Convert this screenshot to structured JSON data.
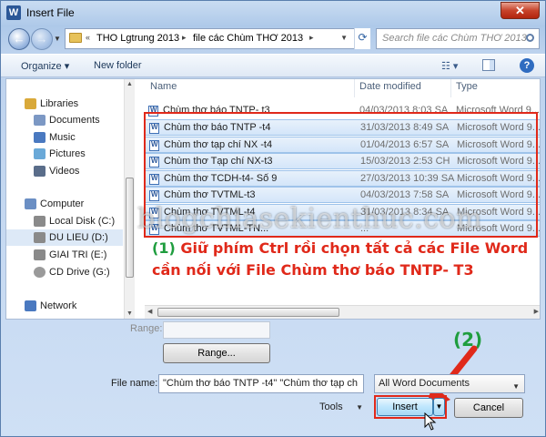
{
  "window": {
    "title": "Insert File",
    "close": "✕"
  },
  "nav": {
    "path": [
      "THO Lgtrung 2013",
      "file các Chùm THƠ 2013"
    ],
    "search_placeholder": "Search file các Chùm THƠ 2013"
  },
  "toolbar": {
    "organize": "Organize ▾",
    "new_folder": "New folder"
  },
  "tree": [
    {
      "label": "Libraries",
      "icon": "libraries-icon",
      "color": "#d9a93a"
    },
    {
      "label": "Documents",
      "icon": "documents-icon",
      "color": "#7c98c4"
    },
    {
      "label": "Music",
      "icon": "music-icon",
      "color": "#4a79c0"
    },
    {
      "label": "Pictures",
      "icon": "pictures-icon",
      "color": "#6aa9d8"
    },
    {
      "label": "Videos",
      "icon": "videos-icon",
      "color": "#5a6d8a"
    },
    {
      "label": "Computer",
      "icon": "computer-icon",
      "color": "#6b8fc4"
    },
    {
      "label": "Local Disk (C:)",
      "icon": "disk-icon",
      "color": "#8a8a8a"
    },
    {
      "label": "DU LIEU (D:)",
      "icon": "disk-icon",
      "color": "#8a8a8a"
    },
    {
      "label": "GIAI TRI (E:)",
      "icon": "disk-icon",
      "color": "#8a8a8a"
    },
    {
      "label": "CD Drive (G:)",
      "icon": "cd-drive-icon",
      "color": "#9a9a9a"
    },
    {
      "label": "Network",
      "icon": "network-icon",
      "color": "#4a79c0"
    }
  ],
  "columns": {
    "name": "Name",
    "date": "Date modified",
    "type": "Type"
  },
  "files": [
    {
      "name": "Chùm thơ báo TNTP- t3",
      "date": "04/03/2013 8:03 SA",
      "type": "Microsoft Word 9...",
      "selected": false
    },
    {
      "name": "Chùm thơ báo TNTP -t4",
      "date": "31/03/2013 8:49 SA",
      "type": "Microsoft Word 9...",
      "selected": true
    },
    {
      "name": "Chùm thơ tạp chí NX -t4",
      "date": "01/04/2013 6:57 SA",
      "type": "Microsoft Word 9...",
      "selected": true
    },
    {
      "name": "Chùm thơ Tạp chí NX-t3",
      "date": "15/03/2013 2:53 CH",
      "type": "Microsoft Word 9...",
      "selected": true
    },
    {
      "name": "Chùm thơ TCDH-t4- Số 9",
      "date": "27/03/2013 10:39 SA",
      "type": "Microsoft Word 9...",
      "selected": true
    },
    {
      "name": "Chùm thơ TVTML-t3",
      "date": "04/03/2013 7:58 SA",
      "type": "Microsoft Word 9...",
      "selected": true
    },
    {
      "name": "Chùm thơ TVTML-t4",
      "date": "31/03/2013 8:34 SA",
      "type": "Microsoft Word 9...",
      "selected": true
    },
    {
      "name": "Chùm thơ TVTML-TN...",
      "date": "...",
      "type": "Microsoft Word 9...",
      "selected": true
    }
  ],
  "annotation1": {
    "num": "(1)",
    "text": "Giữ phím Ctrl rồi chọn tất cả các File Word cần nối với File Chùm thơ báo TNTP- T3"
  },
  "annotation2": "(2)",
  "watermark": "blogchiasekienthuc.com",
  "range": {
    "label": "Range:",
    "button": "Range..."
  },
  "filename": {
    "label": "File name:",
    "value": "\"Chùm thơ báo TNTP -t4\" \"Chùm thơ tạp ch"
  },
  "filetype": "All Word Documents",
  "tools": "Tools",
  "insert": "Insert",
  "cancel": "Cancel"
}
